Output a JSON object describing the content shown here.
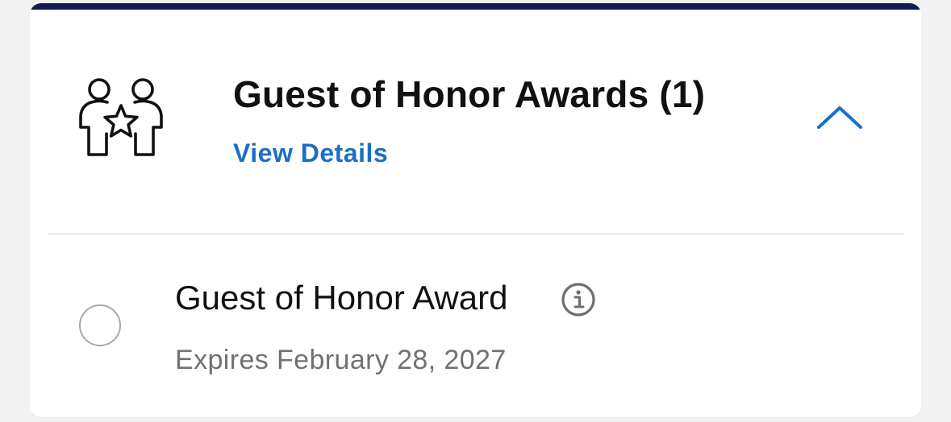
{
  "colors": {
    "card_accent_bar": "#0f1c56",
    "link_blue": "#1a6fc4",
    "title_text": "#111111",
    "secondary_text": "#717171",
    "divider": "#cfcfcf",
    "radio_border": "#a9a9a9",
    "background": "#f2f2f2"
  },
  "section": {
    "icon": "guests-with-star-icon",
    "title": "Guest of Honor Awards (1)",
    "details_link": "View Details",
    "toggle_icon": "chevron-up-icon",
    "expanded": true
  },
  "awards": [
    {
      "name": "Guest of Honor Award",
      "info_icon": "info-icon",
      "expiry": "Expires February 28, 2027",
      "selected": false
    }
  ]
}
